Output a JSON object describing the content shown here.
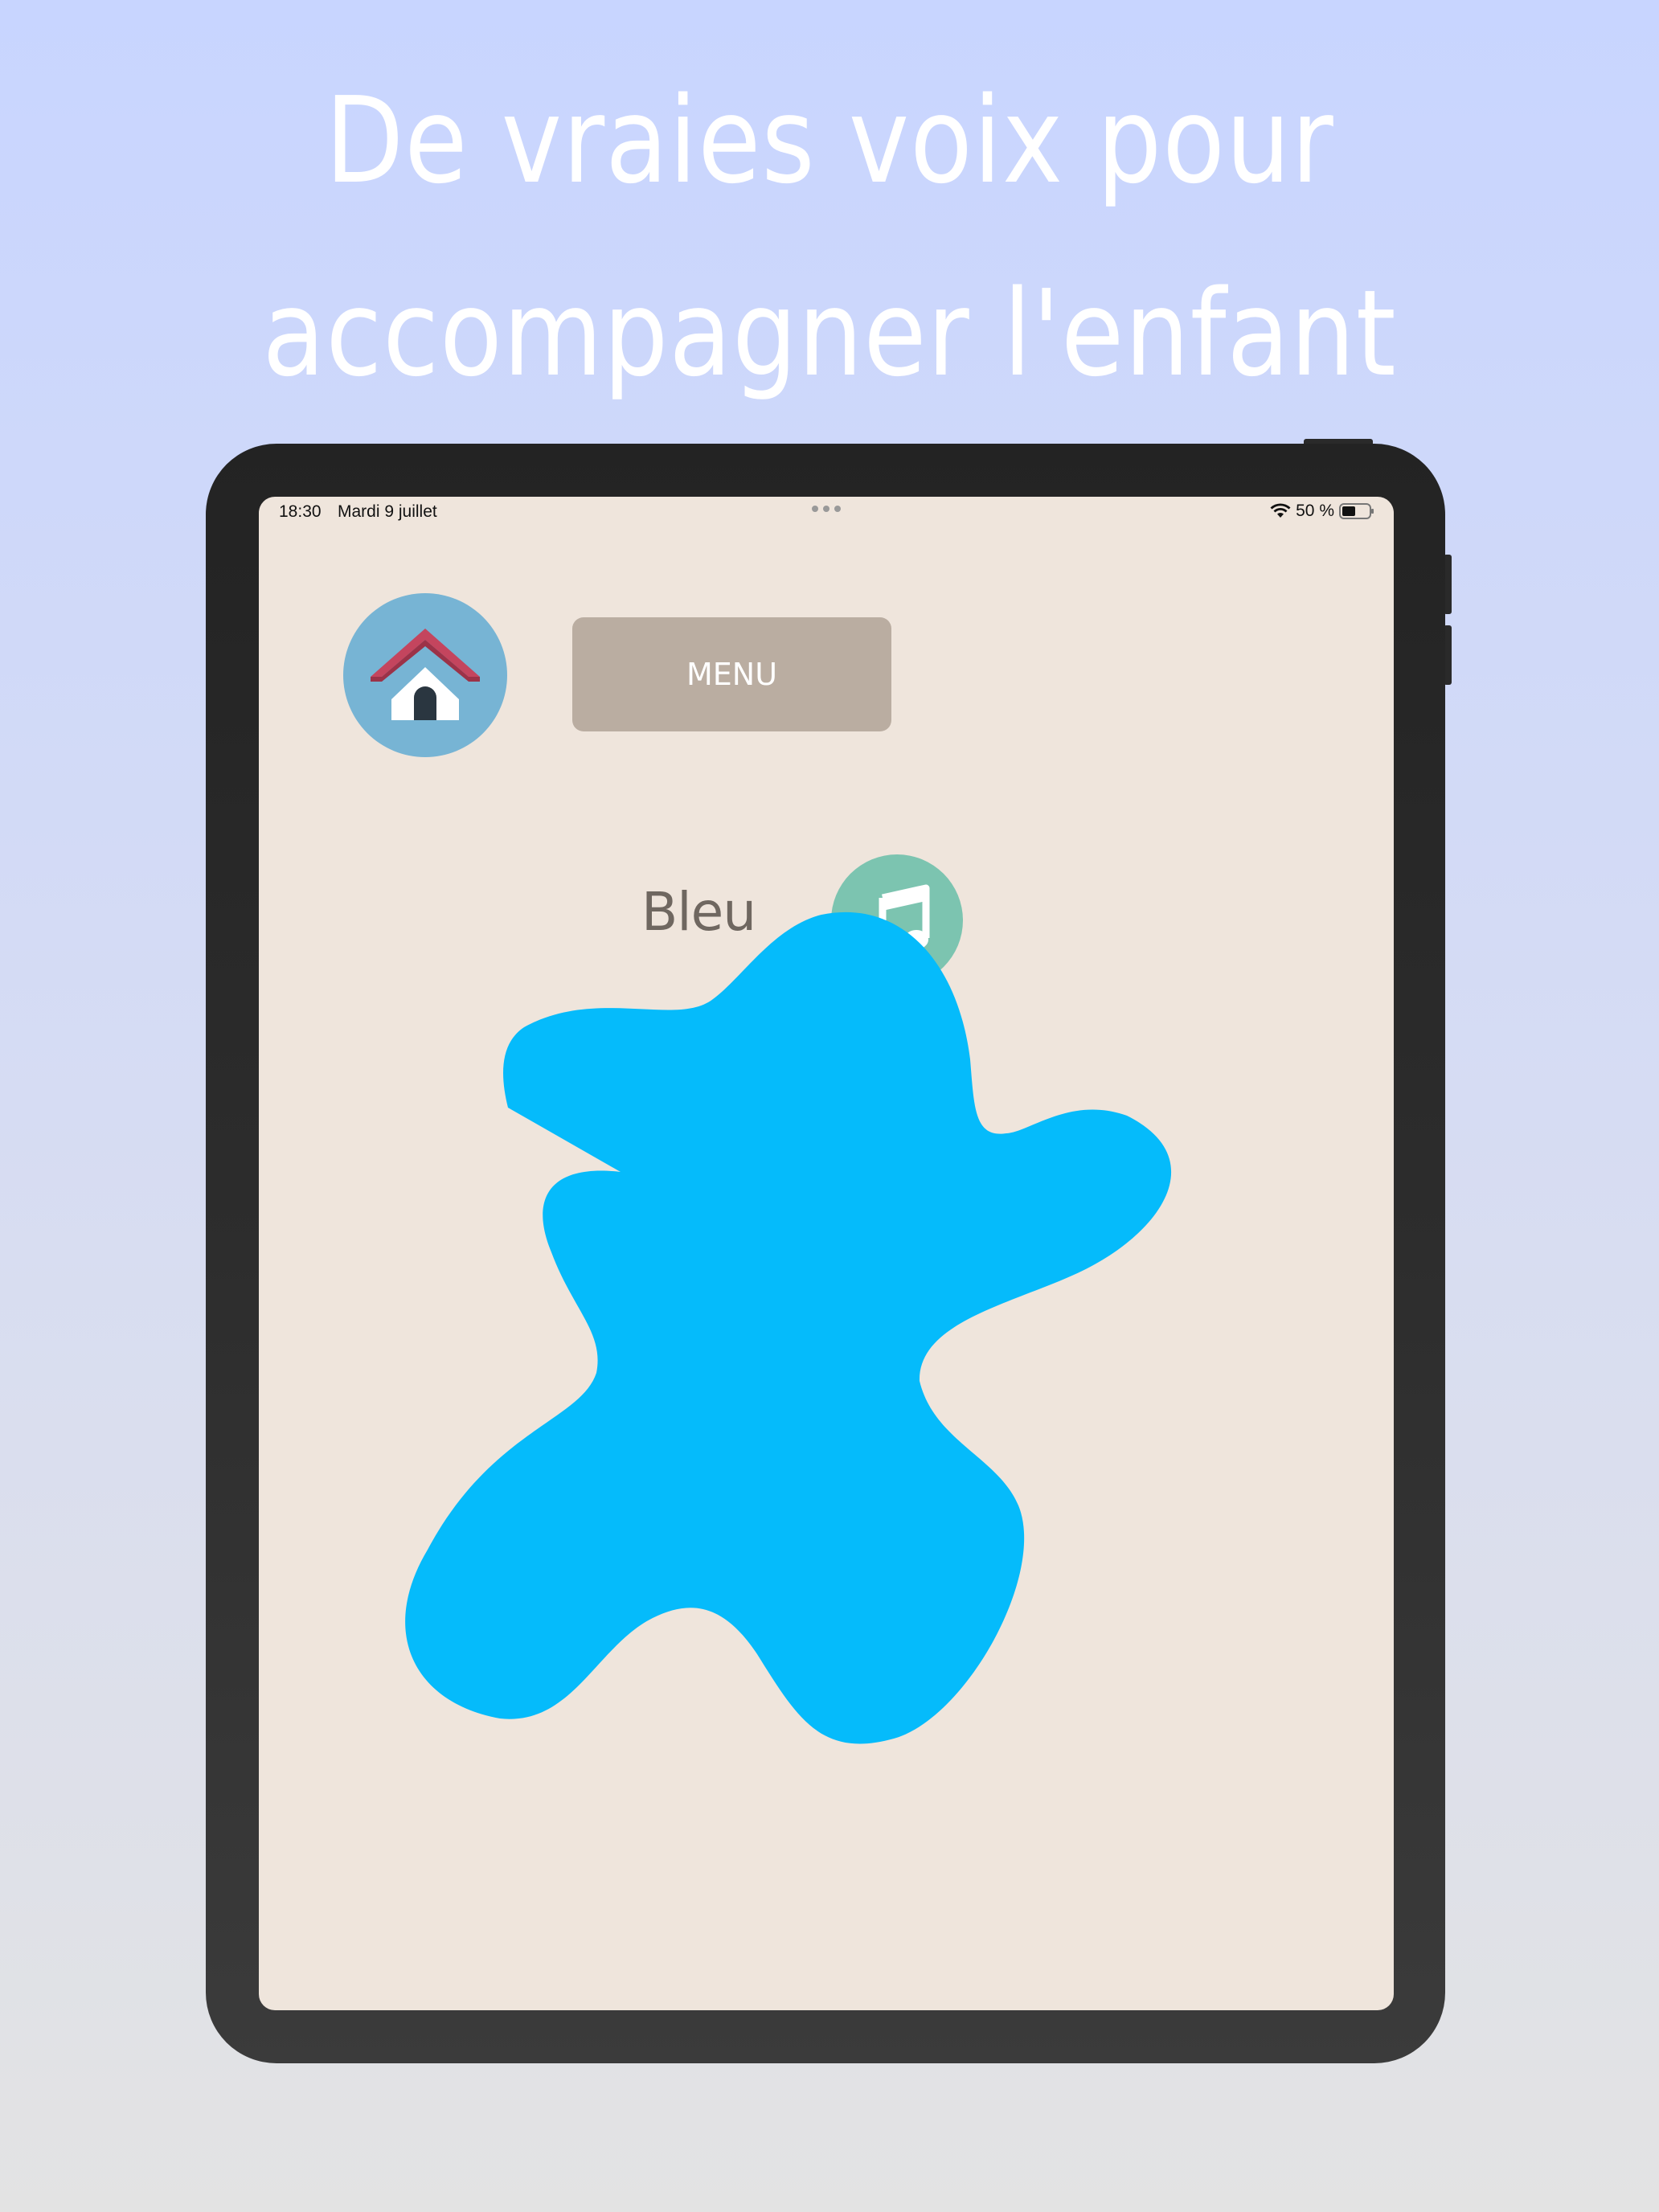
{
  "headline": {
    "line1": "De vraies voix pour",
    "line2": "accompagner l'enfant"
  },
  "status_bar": {
    "time": "18:30",
    "date": "Mardi 9 juillet",
    "battery": "50 %"
  },
  "app": {
    "home_icon": "home-icon",
    "menu_label": "MENU",
    "color_name": "Bleu",
    "sound_icon": "music-note-icon",
    "blob_color": "#05bbfb"
  },
  "colors": {
    "background_top": "#c8d5ff",
    "background_bottom": "#e3e3e3",
    "screen": "#efe5dc",
    "home_button": "#77b4d4",
    "menu_button": "#baada1",
    "sound_button": "#7cc4b0",
    "blob": "#05bbfb"
  }
}
